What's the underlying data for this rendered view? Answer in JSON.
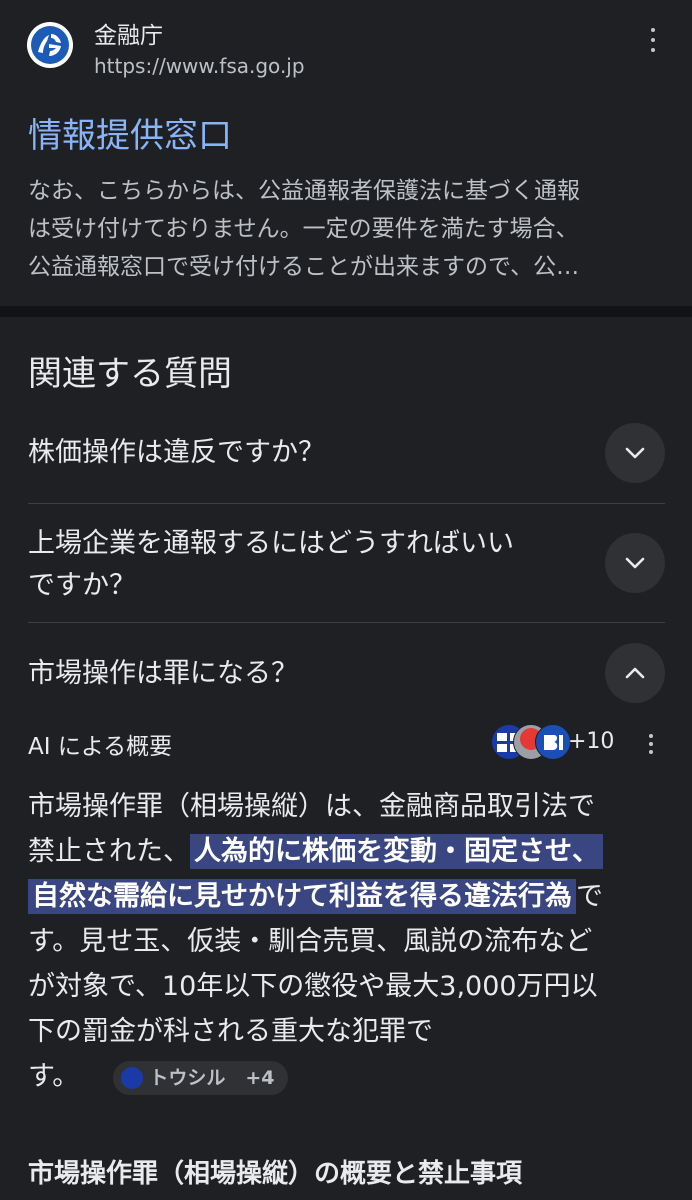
{
  "result": {
    "site_name": "金融庁",
    "url": "https://www.fsa.go.jp",
    "title": "情報提供窓口",
    "snippet_lines": [
      "なお、こちらからは、公益通報者保護法に基づく通報",
      "は受け付けておりません。一定の要件を満たす場合、",
      "公益通報窓口で受け付けることが出来ますので、公…"
    ]
  },
  "related_questions": {
    "heading": "関連する質問",
    "items": [
      {
        "lines": [
          "株価操作は違反ですか？"
        ],
        "expanded": false
      },
      {
        "lines": [
          "上場企業を通報するにはどうすればいい",
          "ですか？"
        ],
        "expanded": false
      },
      {
        "lines": [
          "市場操作は罪になる？"
        ],
        "expanded": true
      }
    ]
  },
  "ai_overview": {
    "label": "AI による概要",
    "source_icons": [
      "toushiru-icon",
      "red-circle-icon",
      "bi-icon"
    ],
    "source_count": "+10",
    "answer": {
      "line1": "市場操作罪（相場操縦）は、金融商品取引法で",
      "line2_pre": "禁止された、",
      "line2_hl": "人為的に株価を変動・固定させ、",
      "line3_hl": "自然な需給に見せかけて利益を得る違法行為",
      "line3_post": "で",
      "line4": "す。見せ玉、仮装・馴合売買、風説の流布など",
      "line5": "が対象で、10年以下の懲役や最大3,000万円以",
      "line6": "下の罰金が科される重大な犯罪で",
      "line7": "す。"
    },
    "citation": {
      "source": "トウシル",
      "more": "+4"
    },
    "sub_heading": "市場操作罪（相場操縦）の概要と禁止事項"
  },
  "colors": {
    "background": "#1f2024",
    "link": "#8ab4f8",
    "highlight": "#394681",
    "divider": "#3c4043"
  }
}
